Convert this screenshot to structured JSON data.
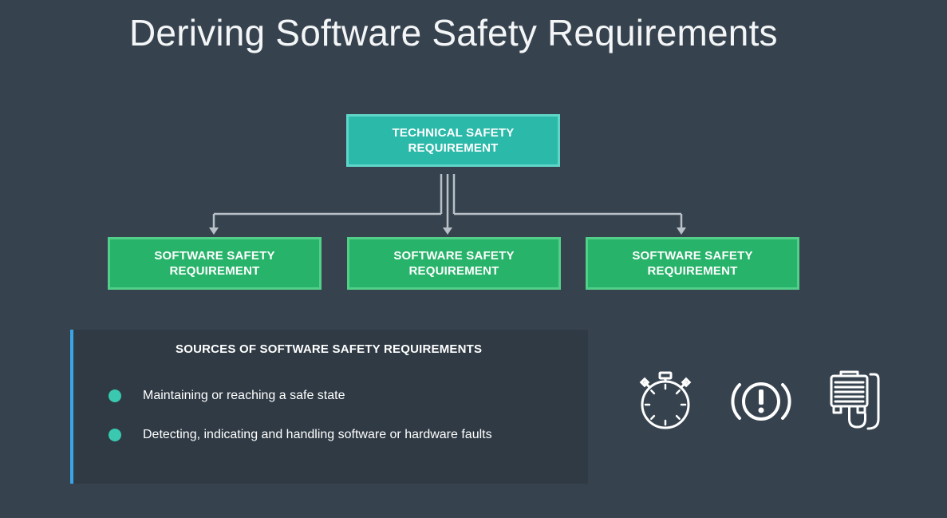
{
  "slide": {
    "title": "Deriving Software Safety Requirements"
  },
  "diagram": {
    "top_box": "TECHNICAL SAFETY REQUIREMENT",
    "child_boxes": [
      "SOFTWARE SAFETY REQUIREMENT",
      "SOFTWARE SAFETY REQUIREMENT",
      "SOFTWARE SAFETY REQUIREMENT"
    ]
  },
  "sources_panel": {
    "heading": "SOURCES OF SOFTWARE SAFETY REQUIREMENTS",
    "items": [
      "Maintaining or reaching a safe state",
      "Detecting, indicating and handling software or hardware faults"
    ]
  },
  "icons": [
    "stopwatch-icon",
    "brake-warning-icon",
    "connector-cable-icon"
  ],
  "colors": {
    "background": "#36434f",
    "technical_box": "#2bb9a9",
    "software_box": "#27b36a",
    "panel": "#2f3a44",
    "panel_accent": "#3aa5e6",
    "bullet": "#3ac9b0"
  }
}
